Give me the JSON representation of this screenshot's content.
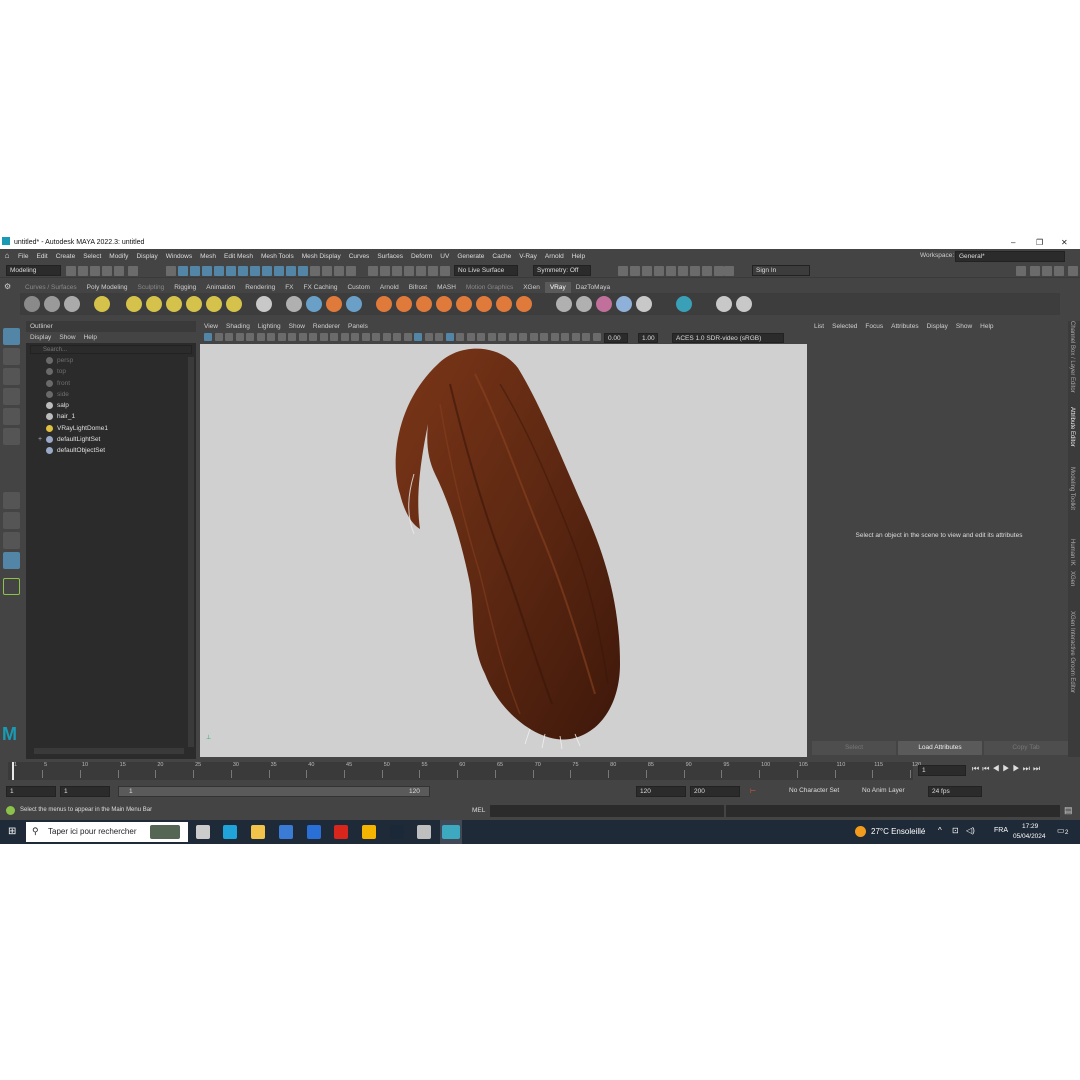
{
  "window": {
    "title": "untitled* - Autodesk MAYA 2022.3: untitled",
    "minimize": "–",
    "restore": "❐",
    "close": "✕"
  },
  "menu": [
    "File",
    "Edit",
    "Create",
    "Select",
    "Modify",
    "Display",
    "Windows",
    "Mesh",
    "Edit Mesh",
    "Mesh Tools",
    "Mesh Display",
    "Curves",
    "Surfaces",
    "Deform",
    "UV",
    "Generate",
    "Cache",
    "V-Ray",
    "Arnold",
    "Help"
  ],
  "workspace": {
    "label": "Workspace:",
    "value": "General*"
  },
  "status": {
    "mode": "Modeling",
    "live_surface": "No Live Surface",
    "symmetry": "Symmetry: Off",
    "sign_in": "Sign In"
  },
  "shelf_tabs": [
    {
      "label": "Curves / Surfaces",
      "state": "dim"
    },
    {
      "label": "Poly Modeling",
      "state": "normal"
    },
    {
      "label": "Sculpting",
      "state": "dim"
    },
    {
      "label": "Rigging",
      "state": "normal"
    },
    {
      "label": "Animation",
      "state": "normal"
    },
    {
      "label": "Rendering",
      "state": "normal"
    },
    {
      "label": "FX",
      "state": "normal"
    },
    {
      "label": "FX Caching",
      "state": "normal"
    },
    {
      "label": "Custom",
      "state": "normal"
    },
    {
      "label": "Arnold",
      "state": "normal"
    },
    {
      "label": "Bifrost",
      "state": "normal"
    },
    {
      "label": "MASH",
      "state": "normal"
    },
    {
      "label": "Motion Graphics",
      "state": "dim"
    },
    {
      "label": "XGen",
      "state": "normal"
    },
    {
      "label": "VRay",
      "state": "active"
    },
    {
      "label": "DazToMaya",
      "state": "normal"
    }
  ],
  "outliner": {
    "title": "Outliner",
    "menu": [
      "Display",
      "Show",
      "Help"
    ],
    "search_placeholder": "Search...",
    "items": [
      {
        "label": "persp",
        "dim": true,
        "icon": "camera-icon"
      },
      {
        "label": "top",
        "dim": true,
        "icon": "camera-icon"
      },
      {
        "label": "front",
        "dim": true,
        "icon": "camera-icon"
      },
      {
        "label": "side",
        "dim": true,
        "icon": "camera-icon"
      },
      {
        "label": "salp",
        "dim": false,
        "icon": "transform-icon"
      },
      {
        "label": "hair_1",
        "dim": false,
        "icon": "transform-icon"
      },
      {
        "label": "VRayLightDome1",
        "dim": false,
        "icon": "light-icon"
      },
      {
        "label": "defaultLightSet",
        "dim": false,
        "icon": "set-icon"
      },
      {
        "label": "defaultObjectSet",
        "dim": false,
        "icon": "set-icon"
      }
    ],
    "expander": "+"
  },
  "viewport": {
    "menu": [
      "View",
      "Shading",
      "Lighting",
      "Show",
      "Renderer",
      "Panels"
    ],
    "exposure": "0.00",
    "gamma": "1.00",
    "colorspace": "ACES 1.0 SDR-video (sRGB)"
  },
  "attribute_editor": {
    "menu": [
      "List",
      "Selected",
      "Focus",
      "Attributes",
      "Display",
      "Show",
      "Help"
    ],
    "message": "Select an object in the scene to view and edit its attributes",
    "buttons": [
      "Select",
      "Load Attributes",
      "Copy Tab"
    ]
  },
  "side_tabs": [
    "Channel Box / Layer Editor",
    "Attribute Editor",
    "Modeling Toolkit",
    "Human IK",
    "XGen",
    "XGen Interactive Groom Editor"
  ],
  "timeline": {
    "ticks": [
      "1",
      "5",
      "10",
      "15",
      "20",
      "25",
      "30",
      "35",
      "40",
      "45",
      "50",
      "55",
      "60",
      "65",
      "70",
      "75",
      "80",
      "85",
      "90",
      "95",
      "100",
      "105",
      "110",
      "115",
      "120"
    ],
    "current_frame": "1"
  },
  "range": {
    "start": "1",
    "anim_start": "1",
    "slider_start": "1",
    "slider_end": "120",
    "end": "120",
    "anim_end": "200",
    "character_set": "No Character Set",
    "anim_layer": "No Anim Layer",
    "fps": "24 fps"
  },
  "command": {
    "help": "Select the menus to appear in the Main Menu Bar",
    "lang": "MEL"
  },
  "taskbar": {
    "search": "Taper ici pour rechercher",
    "weather": "27°C  Ensoleillé",
    "lang": "FRA",
    "time": "17:29",
    "date": "05/04/2024",
    "notifications": "2"
  },
  "colors": {
    "accent": "#5285a6",
    "panel": "#444444",
    "hair": "#6b2e16"
  }
}
